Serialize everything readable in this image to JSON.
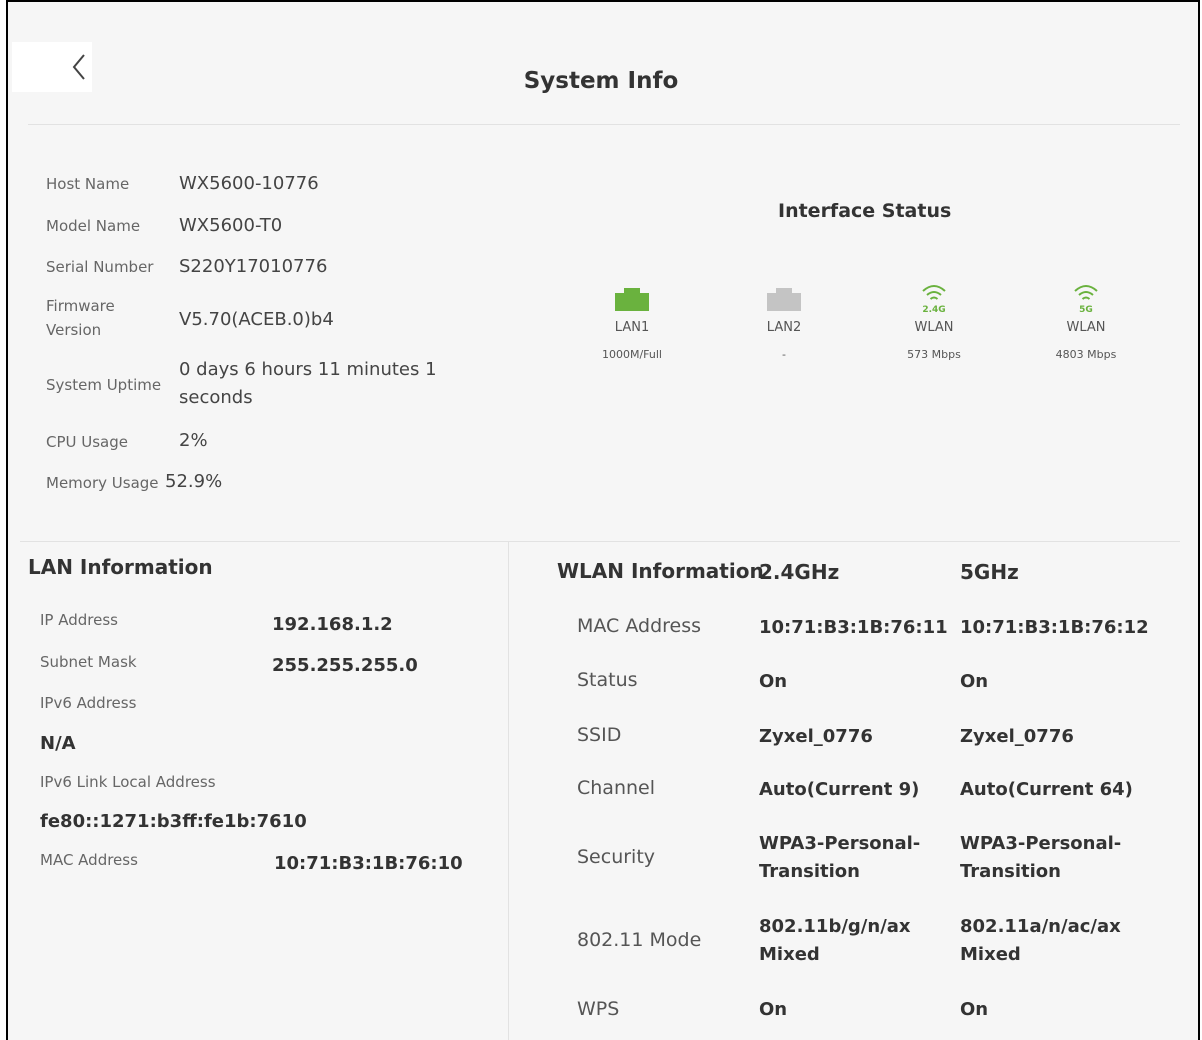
{
  "header": {
    "title": "System Info"
  },
  "system": {
    "host_name_label": "Host Name",
    "host_name": "WX5600-10776",
    "model_name_label": "Model Name",
    "model_name": "WX5600-T0",
    "serial_label": "Serial Number",
    "serial": "S220Y17010776",
    "firmware_label_1": "Firmware",
    "firmware_label_2": "Version",
    "firmware": "V5.70(ACEB.0)b4",
    "uptime_label": "System Uptime",
    "uptime_line1": "0 days 6 hours 11 minutes 1",
    "uptime_line2": "seconds",
    "cpu_label": "CPU Usage",
    "cpu": "2%",
    "memory_label": "Memory Usage",
    "memory": "52.9%"
  },
  "interface_status": {
    "title": "Interface Status",
    "items": [
      {
        "name": "LAN1",
        "rate": "1000M/Full",
        "icon": "ethernet-port-icon",
        "color": "#6ab23e"
      },
      {
        "name": "LAN2",
        "rate": "-",
        "icon": "ethernet-port-icon",
        "color": "#c4c4c4"
      },
      {
        "name": "WLAN",
        "band": "2.4G",
        "rate": "573 Mbps",
        "icon": "wifi-icon",
        "color": "#6ab23e"
      },
      {
        "name": "WLAN",
        "band": "5G",
        "rate": "4803 Mbps",
        "icon": "wifi-icon",
        "color": "#6ab23e"
      }
    ]
  },
  "lan": {
    "title": "LAN Information",
    "ip_label": "IP Address",
    "ip": "192.168.1.2",
    "subnet_label": "Subnet Mask",
    "subnet": "255.255.255.0",
    "ipv6_label": "IPv6 Address",
    "ipv6": "N/A",
    "ipv6_ll_label": "IPv6 Link Local Address",
    "ipv6_ll": "fe80::1271:b3ff:fe1b:7610",
    "mac_label": "MAC Address",
    "mac": "10:71:B3:1B:76:10"
  },
  "wlan": {
    "title": "WLAN Information",
    "band_24": "2.4GHz",
    "band_5": "5GHz",
    "rows": [
      {
        "label": "MAC Address",
        "v24": "10:71:B3:1B:76:11",
        "v5": "10:71:B3:1B:76:12"
      },
      {
        "label": "Status",
        "v24": "On",
        "v5": "On"
      },
      {
        "label": "SSID",
        "v24": "Zyxel_0776",
        "v5": "Zyxel_0776"
      },
      {
        "label": "Channel",
        "v24": "Auto(Current 9)",
        "v5": "Auto(Current 64)"
      },
      {
        "label": "Security",
        "v24_1": "WPA3-Personal-",
        "v24_2": "Transition",
        "v5_1": "WPA3-Personal-",
        "v5_2": "Transition"
      },
      {
        "label": "802.11 Mode",
        "v24_1": "802.11b/g/n/ax",
        "v24_2": "Mixed",
        "v5_1": "802.11a/n/ac/ax",
        "v5_2": "Mixed"
      },
      {
        "label": "WPS",
        "v24": "On",
        "v5": "On"
      }
    ]
  }
}
